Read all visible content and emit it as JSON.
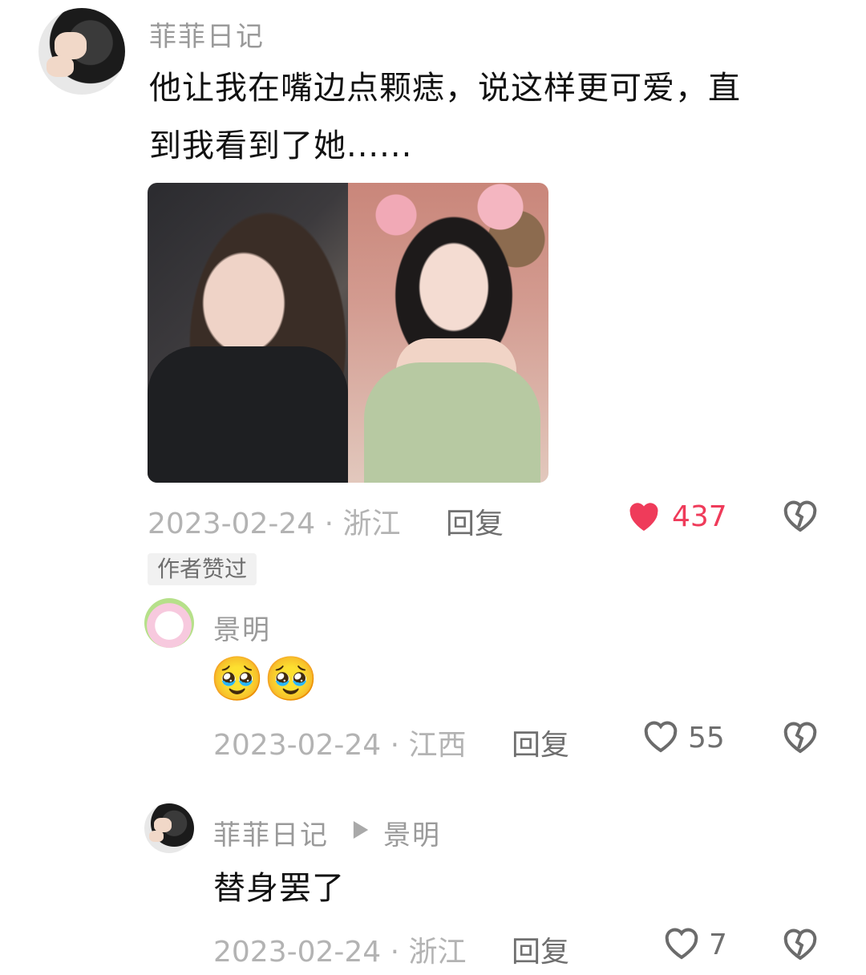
{
  "comment": {
    "author": "菲菲日记",
    "text_line1": "他让我在嘴边点颗痣，说这样更可爱，直",
    "text_line2": "到我看到了她......",
    "date_loc": "2023-02-24 · 浙江",
    "reply_label": "回复",
    "likes": "437",
    "badge": "作者赞过"
  },
  "replies": [
    {
      "author": "景明",
      "text": "🥹🥹",
      "date_loc": "2023-02-24 · 江西",
      "reply_label": "回复",
      "likes": "55"
    },
    {
      "author": "菲菲日记",
      "reply_to": "景明",
      "text": "替身罢了",
      "date_loc": "2023-02-24 · 浙江",
      "reply_label": "回复",
      "likes": "7"
    }
  ],
  "colors": {
    "like_active": "#ef3b5a",
    "meta": "#b3b3b3",
    "name": "#9a9a9a"
  },
  "icons": [
    "heart-filled-icon",
    "heart-outline-icon",
    "broken-heart-icon",
    "play-triangle-icon"
  ]
}
